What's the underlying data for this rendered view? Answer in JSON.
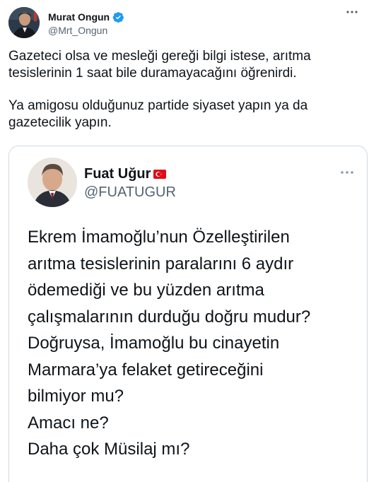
{
  "tweet": {
    "author_name": "Murat Ongun",
    "author_handle": "@Mrt_Ongun",
    "more_icon": "more-dots-icon",
    "verified_icon": "verified-badge-icon",
    "paragraphs": [
      "Gazeteci olsa ve mesleği gereği bilgi istese, arıtma tesislerinin 1 saat bile duramayacağını öğrenirdi.",
      "Ya amigosu olduğunuz partide siyaset yapın ya da gazetecilik yapın."
    ]
  },
  "quoted": {
    "author_name": "Fuat Uğur",
    "author_handle": "@FUATUGUR",
    "flag_icon": "turkey-flag-icon",
    "more_icon": "more-dots-icon",
    "lines": [
      "Ekrem İmamoğlu’nun Özelleştirilen",
      "arıtma tesislerinin paralarını 6 aydır",
      "ödemediği ve bu yüzden arıtma",
      "çalışmalarının durduğu doğru mudur?",
      "Doğruysa, İmamoğlu bu cinayetin",
      "Marmara’ya felaket getireceğini",
      "bilmiyor mu?",
      "Amacı ne?",
      "Daha çok Müsilaj mı?"
    ]
  },
  "colors": {
    "verified": "#1d9bf0",
    "flag_red": "#e30a17",
    "secondary_text": "#536471",
    "border": "#cfd9de"
  }
}
